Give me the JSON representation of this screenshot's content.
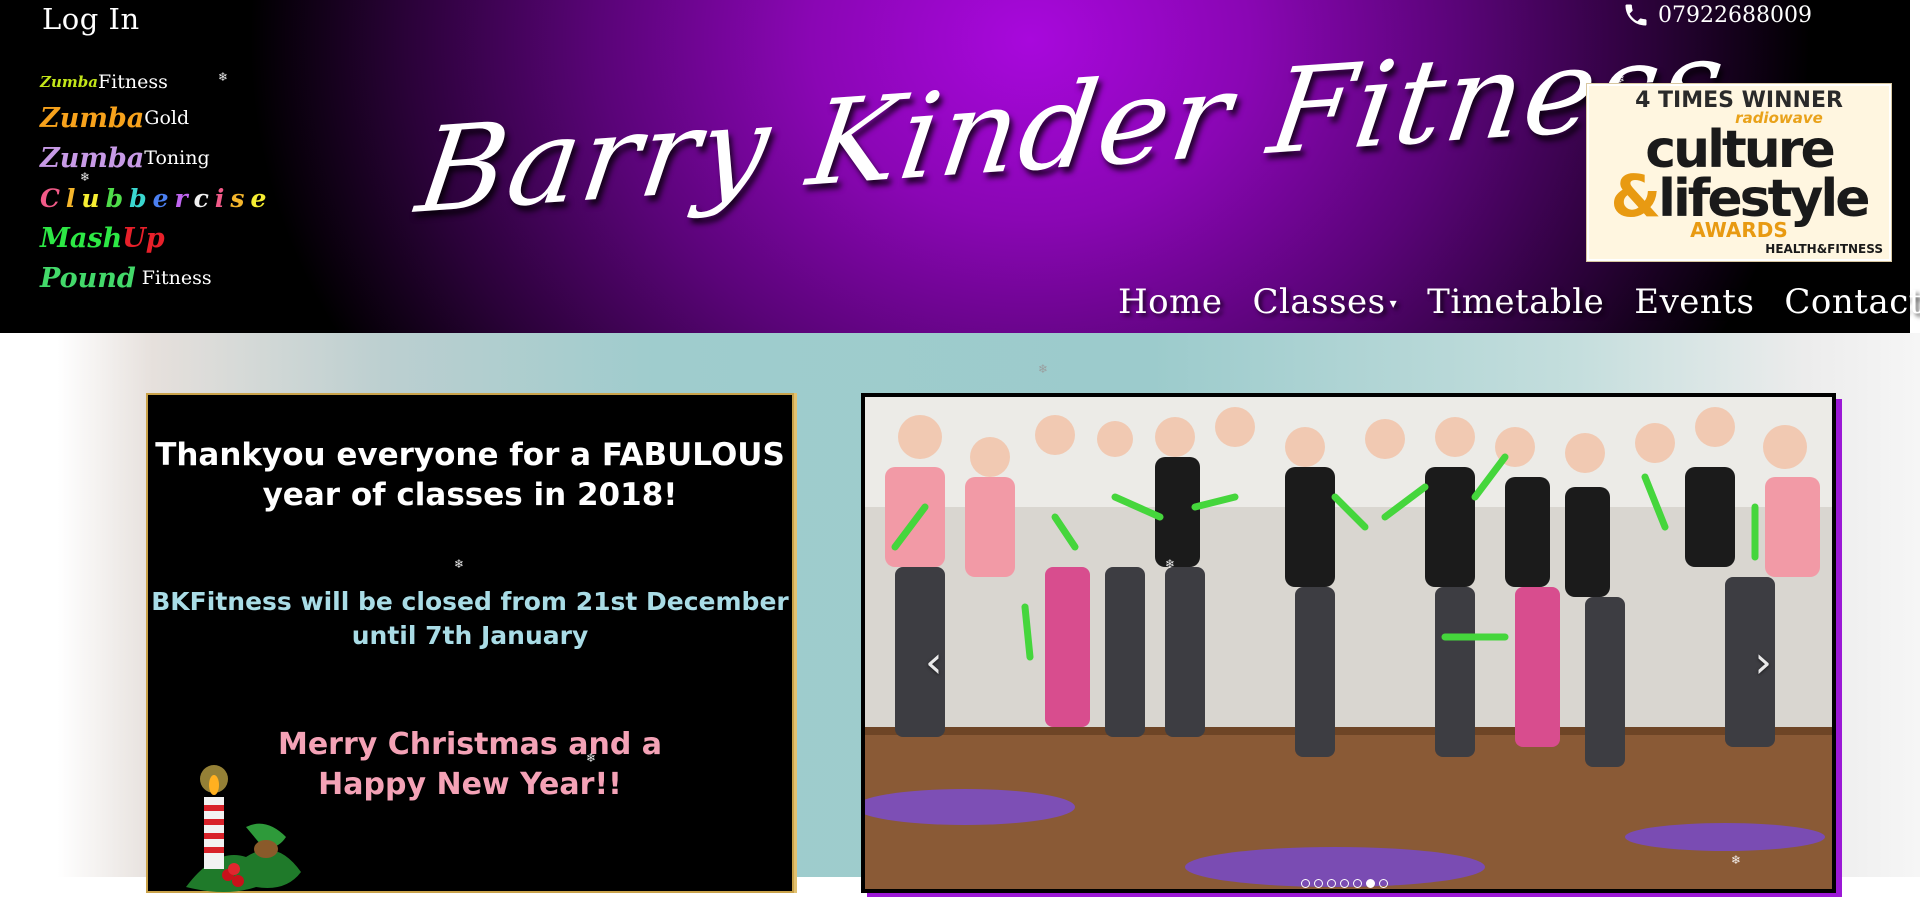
{
  "header": {
    "login_label": "Log In",
    "phone": "07922688009",
    "logo_text": "Barry Kinder Fitness",
    "classes": [
      {
        "brand": "Zumba",
        "suffix": "Fitness"
      },
      {
        "brand": "Zumba",
        "suffix": "Gold"
      },
      {
        "brand": "Zumba",
        "suffix": "Toning"
      },
      {
        "brand": "Clubbercise",
        "suffix": ""
      },
      {
        "brand_a": "Mash",
        "brand_b": "Up",
        "suffix": ""
      },
      {
        "brand": "Pound",
        "suffix": "Fitness"
      }
    ],
    "award": {
      "line1": "4 TIMES WINNER",
      "line2": "radiowave",
      "line3_amp": "&",
      "line3_a": "culture",
      "line3_b": "lifestyle",
      "line4": "AWARDS",
      "line5": "HEALTH&FITNESS"
    },
    "nav": {
      "home": "Home",
      "classes": "Classes",
      "timetable": "Timetable",
      "events": "Events",
      "contact": "Contact"
    }
  },
  "notice": {
    "title_line1": "Thankyou everyone for a FABULOUS",
    "title_line2": "year of classes in 2018!",
    "closed_line1": "BKFitness will be closed from 21st December",
    "closed_line2": "until 7th January",
    "xmas_line1": "Merry Christmas and a",
    "xmas_line2": "Happy New Year!!"
  },
  "slideshow": {
    "prev_label": "‹",
    "next_label": "›",
    "indicator_count": 7,
    "active_index": 5
  },
  "colors": {
    "header_purple": "#a808dc",
    "notice_closed": "#a9dce6",
    "notice_xmas": "#f4a2b6",
    "slide_shadow": "#9b18d6"
  }
}
